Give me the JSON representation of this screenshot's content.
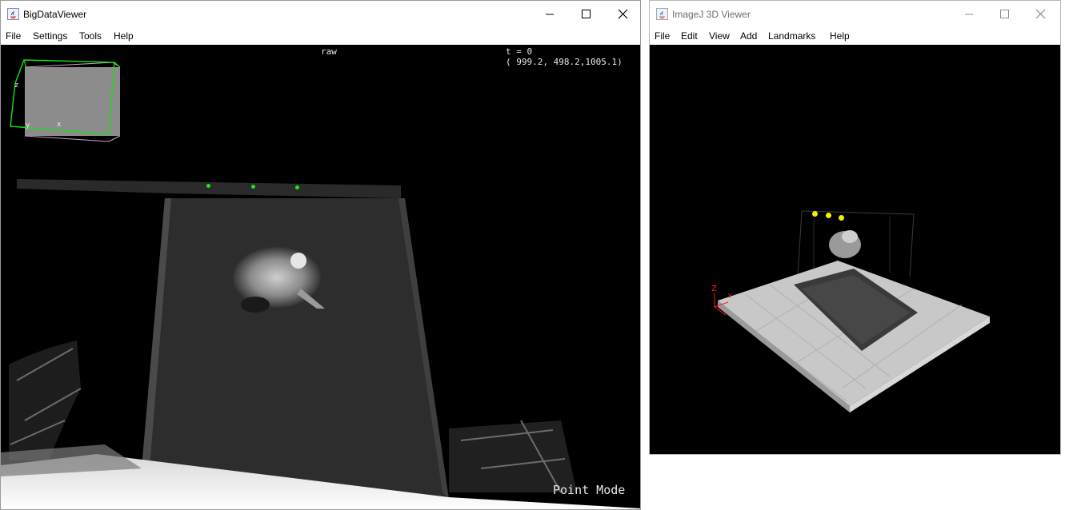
{
  "bdv": {
    "title": "BigDataViewer",
    "menu": [
      "File",
      "Settings",
      "Tools",
      "Help"
    ],
    "source_name": "raw",
    "timepoint": "t = 0",
    "coordinates": "( 999.2, 498.2,1005.1)",
    "mode": "Point Mode",
    "box_labels": {
      "z": "z",
      "y": "y",
      "x": "x"
    },
    "landmark_color": "#22e322"
  },
  "ij3d": {
    "title": "ImageJ 3D Viewer",
    "menu": [
      "File",
      "Edit",
      "View",
      "Add",
      "Landmarks",
      "Help"
    ],
    "axis_labels": {
      "z": "Z",
      "y": "Y"
    },
    "landmark_color": "#f0f000"
  }
}
